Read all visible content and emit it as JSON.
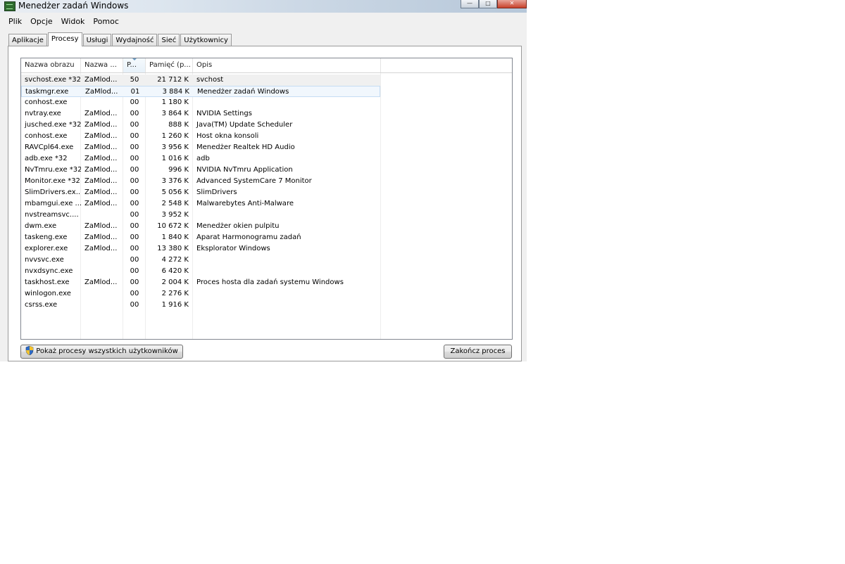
{
  "window": {
    "title": "Menedżer zadań Windows"
  },
  "menu": [
    "Plik",
    "Opcje",
    "Widok",
    "Pomoc"
  ],
  "tabs": [
    "Aplikacje",
    "Procesy",
    "Usługi",
    "Wydajność",
    "Sieć",
    "Użytkownicy"
  ],
  "active_tab": "Procesy",
  "columns": [
    "Nazwa obrazu",
    "Nazwa ...",
    "P...",
    "Pamięć (p...",
    "Opis"
  ],
  "processes": [
    {
      "name": "svchost.exe *32",
      "user": "ZaMlod...",
      "cpu": "50",
      "mem": "21 712 K",
      "desc": "svchost"
    },
    {
      "name": "taskmgr.exe",
      "user": "ZaMlod...",
      "cpu": "01",
      "mem": "3 884 K",
      "desc": "Menedżer zadań Windows"
    },
    {
      "name": "conhost.exe",
      "user": "",
      "cpu": "00",
      "mem": "1 180 K",
      "desc": ""
    },
    {
      "name": "nvtray.exe",
      "user": "ZaMlod...",
      "cpu": "00",
      "mem": "3 864 K",
      "desc": "NVIDIA Settings"
    },
    {
      "name": "jusched.exe *32",
      "user": "ZaMlod...",
      "cpu": "00",
      "mem": "888 K",
      "desc": "Java(TM) Update Scheduler"
    },
    {
      "name": "conhost.exe",
      "user": "ZaMlod...",
      "cpu": "00",
      "mem": "1 260 K",
      "desc": "Host okna konsoli"
    },
    {
      "name": "RAVCpl64.exe",
      "user": "ZaMlod...",
      "cpu": "00",
      "mem": "3 956 K",
      "desc": "Menedżer Realtek HD Audio"
    },
    {
      "name": "adb.exe *32",
      "user": "ZaMlod...",
      "cpu": "00",
      "mem": "1 016 K",
      "desc": "adb"
    },
    {
      "name": "NvTmru.exe *32",
      "user": "ZaMlod...",
      "cpu": "00",
      "mem": "996 K",
      "desc": "NVIDIA NvTmru Application"
    },
    {
      "name": "Monitor.exe *32",
      "user": "ZaMlod...",
      "cpu": "00",
      "mem": "3 376 K",
      "desc": "Advanced SystemCare 7 Monitor"
    },
    {
      "name": "SlimDrivers.ex...",
      "user": "ZaMlod...",
      "cpu": "00",
      "mem": "5 056 K",
      "desc": "SlimDrivers"
    },
    {
      "name": "mbamgui.exe ...",
      "user": "ZaMlod...",
      "cpu": "00",
      "mem": "2 548 K",
      "desc": "Malwarebytes Anti-Malware"
    },
    {
      "name": "nvstreamsvc....",
      "user": "",
      "cpu": "00",
      "mem": "3 952 K",
      "desc": ""
    },
    {
      "name": "dwm.exe",
      "user": "ZaMlod...",
      "cpu": "00",
      "mem": "10 672 K",
      "desc": "Menedżer okien pulpitu"
    },
    {
      "name": "taskeng.exe",
      "user": "ZaMlod...",
      "cpu": "00",
      "mem": "1 840 K",
      "desc": "Aparat Harmonogramu zadań"
    },
    {
      "name": "explorer.exe",
      "user": "ZaMlod...",
      "cpu": "00",
      "mem": "13 380 K",
      "desc": "Eksplorator Windows"
    },
    {
      "name": "nvvsvc.exe",
      "user": "",
      "cpu": "00",
      "mem": "4 272 K",
      "desc": ""
    },
    {
      "name": "nvxdsync.exe",
      "user": "",
      "cpu": "00",
      "mem": "6 420 K",
      "desc": ""
    },
    {
      "name": "taskhost.exe",
      "user": "ZaMlod...",
      "cpu": "00",
      "mem": "2 004 K",
      "desc": "Proces hosta dla zadań systemu Windows"
    },
    {
      "name": "winlogon.exe",
      "user": "",
      "cpu": "00",
      "mem": "2 276 K",
      "desc": ""
    },
    {
      "name": "csrss.exe",
      "user": "",
      "cpu": "00",
      "mem": "1 916 K",
      "desc": ""
    }
  ],
  "buttons": {
    "show_all": "Pokaż procesy wszystkich użytkowników",
    "end_process": "Zakończ proces"
  },
  "icons": {
    "app": "task-manager-icon",
    "shield": "uac-shield-icon",
    "sort": "sort-arrow-icon"
  }
}
